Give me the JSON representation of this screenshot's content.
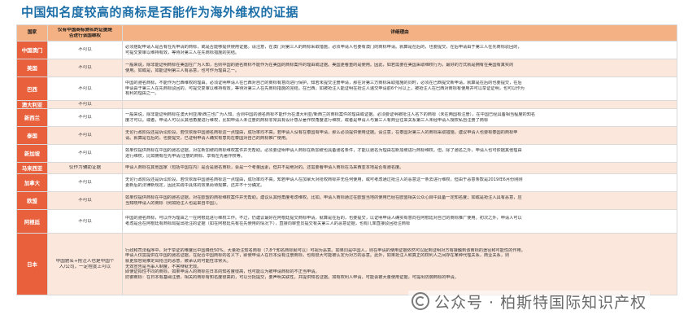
{
  "title": "中国知名度较高的商标是否能作为海外维权的证据",
  "headers": {
    "country": "国家",
    "can_line1": "仅有中国商标驰名的证据是",
    "can_line2": "否进行该国维权",
    "reason": "详细理由"
  },
  "rows": [
    {
      "country": "中国澳门",
      "can": [
        "不可以"
      ],
      "reason": [
        "必须搭配申请人是否有在先申请的商标，或是否能够提供使用证据。请注意，在澳门对第三人的商标采取措施，必须申请人也要有澳门的商标申请。就算是在后的，也要提交，在后申请由于第三人在先商标驳回的，",
        "可提交复审以维持有效，等待对第三人在先商标措施的完结。"
      ]
    },
    {
      "country": "美国",
      "can": [
        "不可以"
      ],
      "reason": [
        "一般来说，除非能证明商标在美国在广为人知，否则中国的驰名商标不能作为在美国的商标案件的理由或证据。美国更看重的是使用。因此，如若需要在美国采取维权行为，最好的方式就是拥有在美国有真实的",
        "使用。如或是，如能证明第三人有恶意，也可作为理由之一。"
      ]
    },
    {
      "country": "巴西",
      "can": [
        "不可以"
      ],
      "reason": [
        "中国的驰名商标，不能作为巴西维权的理由。必须证明申请人在巴西对自己的商标有意向进行保护。知若未提交注册申请，那在对第三方商标采取措施的同时，必须在巴西提交新申请，就算是在后的也要提交，在后",
        "申请由于第三人在先商标驳回的，可提交复审以维持有效，等待对第三人在先商标措施的完结。在巴西，如被抢注人能证明在抢注人递交申请前6个月以上，被抢注人在巴西对商标有使用并可以举证证明，也可以作为",
        "有利的理由之一。"
      ]
    },
    {
      "country": "澳大利亚",
      "can": [
        "不可以"
      ],
      "reason": [
        ""
      ]
    },
    {
      "country": "新西兰",
      "can": [
        "不可以"
      ],
      "reason": [
        "一般来说，除非能证明商标在澳大利亚/新西兰也广为人知，否则中国的驰名商标不能作为在澳大利亚/新西兰的商标案件的理由或证据。必须要证明被抢注人名下的商标（未在两国有注册），在中国已经具备相当程度的知名",
        "度才可以。或者，申请人可以从其他角度进行维权，比如申请人未注册的商标非常具有设计感从著作权角度进行维权，或者是申请人与第三人有商业往来关系第三人未经申请人授权私自注册了商标"
      ]
    },
    {
      "country": "泰国",
      "can": [
        "不可以"
      ],
      "reason": [
        "无论行政阶段还是诉讼阶段，若仅依靠中国驰名商标这一点理由，成功率均不高。若申请人没有在泰国有申请，那么必须提供使用证据。请注意，在泰国对第三人的商标采取措施，建议申请人也要有泰国的商标申",
        "请。就算是在后的，也要提交，已证明申请人确实有意向在泰国对自己的商标推广使用。"
      ]
    },
    {
      "country": "新加坡",
      "can": [
        "不可以"
      ],
      "reason": [
        "如果仅提供商标在中国的驰名证据，对在新加坡的商标维权案件并无帮助。必须要证明申请人商标在新加坡也具备驰名条件，才能以驰名为理由在新加坡进行商标维权。但，除了驰名之外，申请人也可依据其他理由",
        "进行维权，比如拥有在先申请/注册的商标、享有在先著作权等。"
      ]
    },
    {
      "country": "马来西亚",
      "can": [
        "仅作为辅助证据"
      ],
      "reason": [
        "申请人商标在其他国家（包括中国在内）是否是驰名商标，会是一个考量因素，但并不是绝对的。还需要看申请人商标在马来西亚本地是否有驰名度。"
      ]
    },
    {
      "country": "加拿大",
      "can": [
        "不可以"
      ],
      "reason": [
        "无论行政阶段还是诉讼阶段，若仅依靠中国驰名商标这一点理由，成功率均不高。知若申请人在加拿大对抢权商标并无任何使用，或可考虑通过抢注人的恶意这一条去进行维权，但由于恶意条款是2019年6月份刚刚",
        "更新后的法律新规定，因此实践中具体的效果尚待观察，还并不十分确定。"
      ]
    },
    {
      "country": "欧盟",
      "can": [
        "不可以"
      ],
      "reason": [
        "如果仅提供商标在中国的驰名证据，对在欧盟的商标维权案件并无帮助。建议从其他角度考虑维权。比如，申请人商标通过在欧盟当地的使用已经在欧盟相关公众心目中具备一定知名度；如或是抢注人具有恶意，应",
        "当知晓申请人的商标（例如抢注人也是来自中国）。"
      ]
    },
    {
      "country": "阿根廷",
      "can": [
        "不可以"
      ],
      "reason": [
        "中国的驰名商标，可以作为理由之一在阿根廷进行维权工作。不过，仍建议最好在阿根廷提交商标申请，就算是在后的，也要提交，以证明申请人确实有意向在阿根廷对自己的商标推广使用。初次之外，申请人可以",
        "考虑是否在阿根廷有商标局提出抢注的证据（如在阿根廷先有在先使用的情况下），直接向审查员提交有关第三人的恶意证据，也有几率直接驳回抢注商标"
      ]
    },
    {
      "country": "日本",
      "can": [
        "中国驰名+抢注人也是中国个",
        "人/公司，一定程度上可以"
      ],
      "reason": [
        "行政和司法程序中，对于举证的难度比中国降低50%。大量抢注知名商标（7,8个知名商标就可以）可视为恶意。如果同是中国人，则在申请的使用证据依然可以起到证明对方有接触到该商标的途径和可能性的作用，",
        "申请人仅需提供在中国的驰名证据，在配合中国商标的名义下，即使申请人在日本没有注册商标，也有很大可能被认定为对方的恶意。此外，如果抢注人和真正的权利人之间存在某种代理关系，商业关系，则",
        "就更加容易推定出抢注的恶意，被承认的可能性非常大。",
        "无效宣告是当事人制度，不答辩就无效。",
        "即使证拟性不同的商标，如果申请人的商标在日本的知名度很高，也可能以为被申请商标的不正当申请。",
        "防御商标：在日本有基础注册，相关的商标有知名度很高的，可以分批提交，要声明关联性，并提供知名证据。如有权利人申请，可能会被大量使用证据，可提出防御商标的申请。"
      ]
    }
  ],
  "watermark": "公众号 · 柏斯特国际知识产权"
}
